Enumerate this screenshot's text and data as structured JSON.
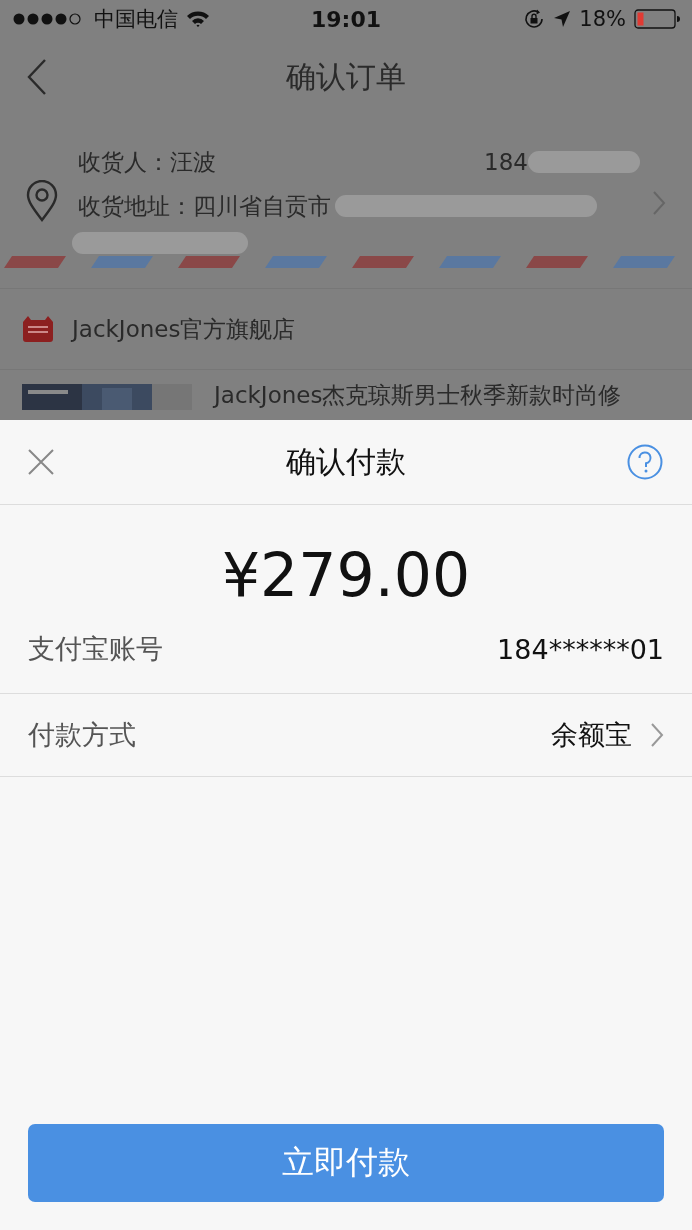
{
  "status_bar": {
    "carrier": "中国电信",
    "time": "19:01",
    "battery": "18%"
  },
  "nav": {
    "title": "确认订单"
  },
  "address": {
    "receiver": "收货人：汪波",
    "phone": "184",
    "address": "收货地址：四川省自贡市"
  },
  "store": {
    "name": "JackJones官方旗舰店"
  },
  "product": {
    "title": "JackJones杰克琼斯男士秋季新款时尚修"
  },
  "sheet": {
    "title": "确认付款",
    "amount": "¥279.00",
    "rows": [
      {
        "kind": "info",
        "label": "支付宝账号",
        "value": "184******01"
      },
      {
        "kind": "choice",
        "label": "付款方式",
        "value": "余额宝"
      }
    ],
    "button": "立即付款"
  }
}
